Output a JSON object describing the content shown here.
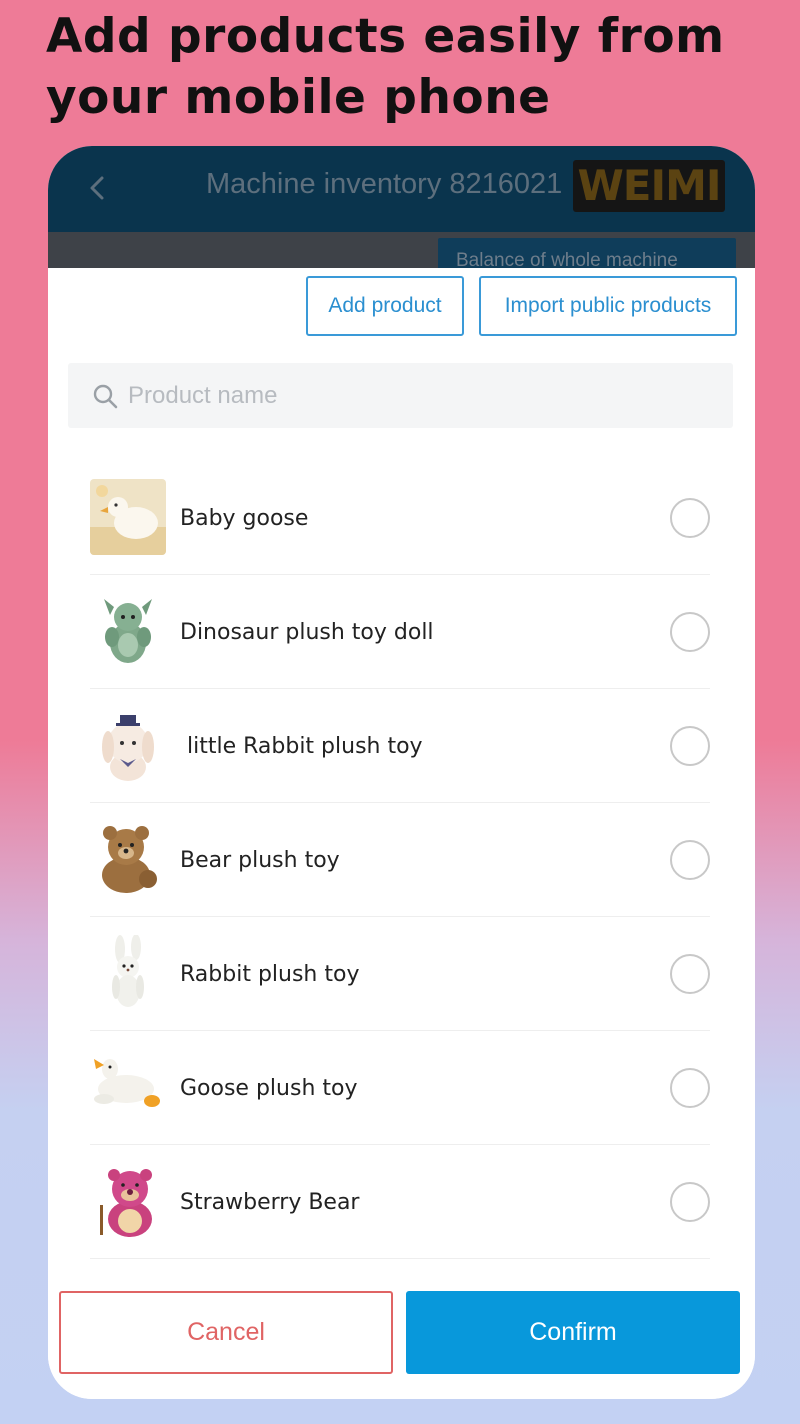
{
  "headline": "Add products easily from your mobile phone",
  "navbar": {
    "title": "Machine inventory 8216021",
    "logo": "WEIMI",
    "balance_label": "Balance of whole machine"
  },
  "toolbar": {
    "add_label": "Add product",
    "import_label": "Import public products"
  },
  "search": {
    "placeholder": "Product name",
    "icon": "search-icon"
  },
  "products": [
    {
      "name": "Baby goose",
      "selected": false
    },
    {
      "name": "Dinosaur plush toy doll",
      "selected": false
    },
    {
      "name": " little Rabbit plush toy",
      "selected": false
    },
    {
      "name": "Bear plush toy",
      "selected": false
    },
    {
      "name": "Rabbit plush toy",
      "selected": false
    },
    {
      "name": "Goose plush toy",
      "selected": false
    },
    {
      "name": "Strawberry Bear",
      "selected": false
    }
  ],
  "footer": {
    "cancel_label": "Cancel",
    "confirm_label": "Confirm"
  },
  "colors": {
    "accent": "#0898db",
    "cancel": "#e06464",
    "navbar": "#0a344d"
  }
}
